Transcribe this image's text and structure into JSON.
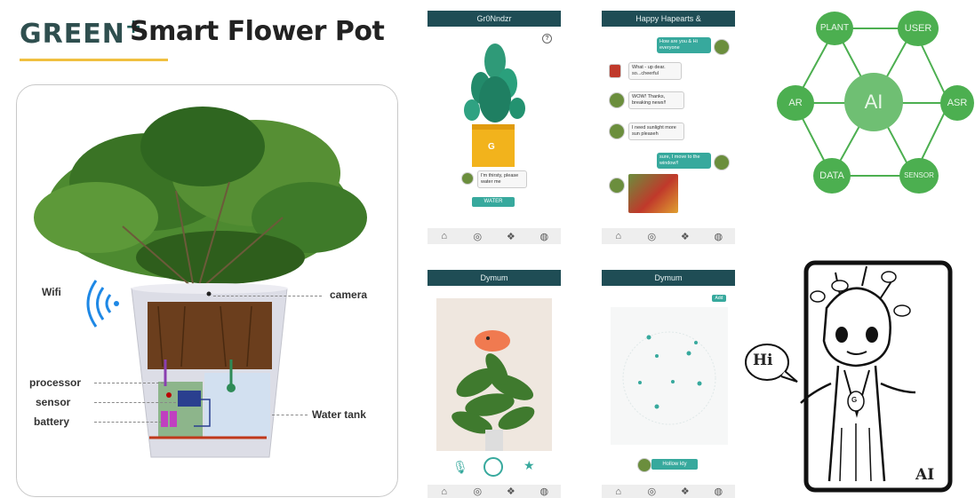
{
  "header": {
    "brand": "GREEN",
    "brand_plus": "+",
    "title": "Smart Flower Pot"
  },
  "pot_diagram": {
    "labels": {
      "wifi": "Wifi",
      "camera": "camera",
      "processor": "processor",
      "sensor": "sensor",
      "battery": "battery",
      "water_tank": "Water tank"
    }
  },
  "screen_growing": {
    "header": "Gr0Nndzr",
    "bubble": "I'm thirsty, please water me",
    "button": "WATER",
    "badge": "G"
  },
  "screen_chat": {
    "header": "Happy Hapearts &",
    "messages": [
      {
        "side": "me",
        "text": "How are you & Hi everyone"
      },
      {
        "side": "plant",
        "text": "What - up dear. so...cheerful"
      },
      {
        "side": "plant",
        "text": "WOW! Thanks, breaking news!!"
      },
      {
        "side": "plant",
        "text": "I need sunlight more sun pleaseh"
      },
      {
        "side": "me",
        "text": "sure, I move to the window!!"
      }
    ]
  },
  "screen_ar": {
    "header": "Dymum",
    "icons": [
      "microphone-icon",
      "record-ring-icon",
      "star-icon"
    ]
  },
  "screen_map": {
    "header": "Dymum",
    "tag": "Add",
    "location_chip": "Hollow kty"
  },
  "hexagon": {
    "center": "AI",
    "nodes": {
      "plant": "PLANT",
      "user": "USER",
      "ar": "AR",
      "asr": "ASR",
      "data": "DATA",
      "sensor": "SENSOR"
    },
    "color": "#4caf50"
  },
  "groot_sketch": {
    "speech": "Hi",
    "corner_tag": "AI",
    "badge": "G"
  },
  "colors": {
    "teal_header": "#1f4d55",
    "teal_accent": "#37a99d",
    "gold_rule": "#f0c040"
  }
}
